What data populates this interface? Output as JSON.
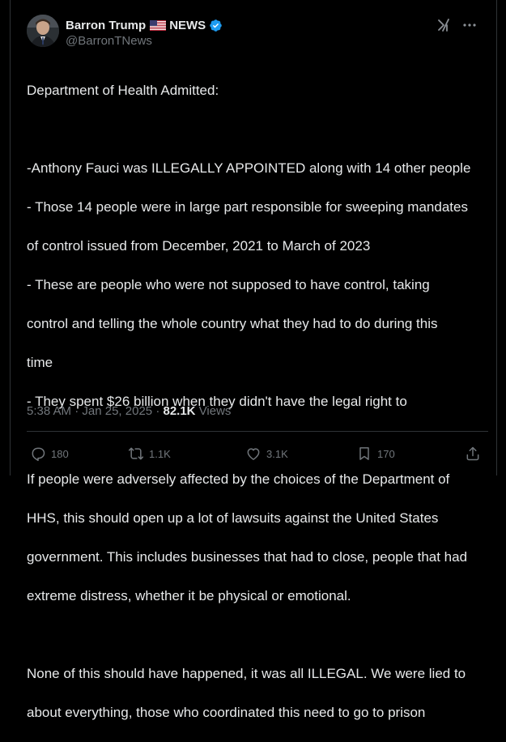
{
  "author": {
    "name": "Barron Trump",
    "flag": "🇺🇸",
    "label": "NEWS",
    "handle": "@BarronTNews",
    "verified_color": "#1d9bf0"
  },
  "icons": {
    "top_right": [
      "grok-icon",
      "more-icon"
    ],
    "actions": [
      "reply-icon",
      "retweet-icon",
      "like-icon",
      "bookmark-icon",
      "share-icon"
    ]
  },
  "post": {
    "paragraphs": [
      [
        "Department of Health Admitted:"
      ],
      [
        "-Anthony Fauci was ILLEGALLY APPOINTED along with 14 other people",
        "- Those 14 people were in large part responsible for sweeping mandates",
        "of control issued from December, 2021 to March of 2023",
        "- These are people who were not supposed to have control, taking",
        "control and telling the whole country what they had to do during this",
        "time",
        "- They spent $26 billion when they didn't have the legal right to"
      ],
      [
        "If people were adversely affected by the choices of the Department of",
        "HHS, this should open up a lot of lawsuits against the United States",
        "government. This includes businesses that had to close, people that had",
        "extreme distress, whether it be physical or emotional."
      ],
      [
        "None of this should have happened, it was all ILLEGAL. We were lied to",
        "about everything, those who coordinated this need to go to prison"
      ]
    ]
  },
  "meta": {
    "time": "5:38 AM",
    "separator": "·",
    "date": "Jan 25, 2025",
    "views_count": "82.1K",
    "views_label": "Views"
  },
  "actions": {
    "replies": "180",
    "reposts": "1.1K",
    "likes": "3.1K",
    "bookmarks": "170"
  }
}
